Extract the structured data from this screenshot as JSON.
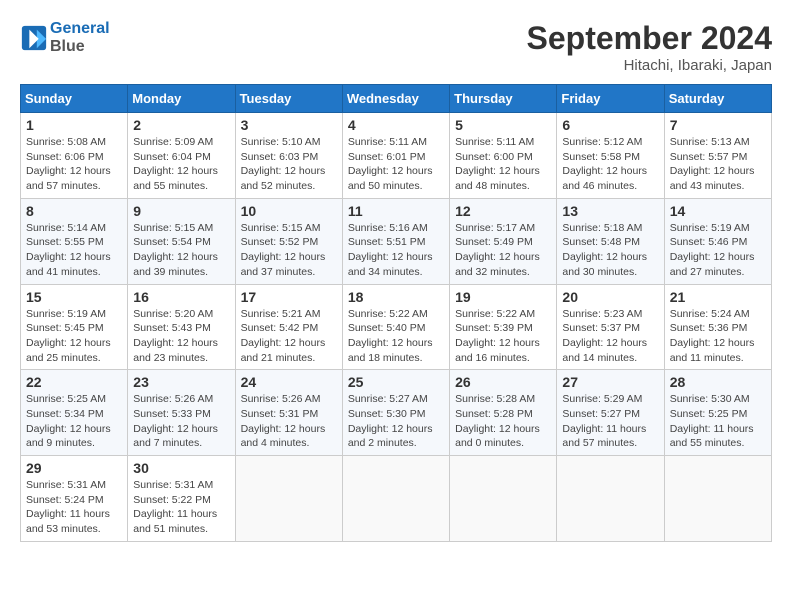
{
  "header": {
    "logo_line1": "General",
    "logo_line2": "Blue",
    "month": "September 2024",
    "location": "Hitachi, Ibaraki, Japan"
  },
  "weekdays": [
    "Sunday",
    "Monday",
    "Tuesday",
    "Wednesday",
    "Thursday",
    "Friday",
    "Saturday"
  ],
  "weeks": [
    [
      {
        "day": "1",
        "sunrise": "Sunrise: 5:08 AM",
        "sunset": "Sunset: 6:06 PM",
        "daylight": "Daylight: 12 hours and 57 minutes."
      },
      {
        "day": "2",
        "sunrise": "Sunrise: 5:09 AM",
        "sunset": "Sunset: 6:04 PM",
        "daylight": "Daylight: 12 hours and 55 minutes."
      },
      {
        "day": "3",
        "sunrise": "Sunrise: 5:10 AM",
        "sunset": "Sunset: 6:03 PM",
        "daylight": "Daylight: 12 hours and 52 minutes."
      },
      {
        "day": "4",
        "sunrise": "Sunrise: 5:11 AM",
        "sunset": "Sunset: 6:01 PM",
        "daylight": "Daylight: 12 hours and 50 minutes."
      },
      {
        "day": "5",
        "sunrise": "Sunrise: 5:11 AM",
        "sunset": "Sunset: 6:00 PM",
        "daylight": "Daylight: 12 hours and 48 minutes."
      },
      {
        "day": "6",
        "sunrise": "Sunrise: 5:12 AM",
        "sunset": "Sunset: 5:58 PM",
        "daylight": "Daylight: 12 hours and 46 minutes."
      },
      {
        "day": "7",
        "sunrise": "Sunrise: 5:13 AM",
        "sunset": "Sunset: 5:57 PM",
        "daylight": "Daylight: 12 hours and 43 minutes."
      }
    ],
    [
      {
        "day": "8",
        "sunrise": "Sunrise: 5:14 AM",
        "sunset": "Sunset: 5:55 PM",
        "daylight": "Daylight: 12 hours and 41 minutes."
      },
      {
        "day": "9",
        "sunrise": "Sunrise: 5:15 AM",
        "sunset": "Sunset: 5:54 PM",
        "daylight": "Daylight: 12 hours and 39 minutes."
      },
      {
        "day": "10",
        "sunrise": "Sunrise: 5:15 AM",
        "sunset": "Sunset: 5:52 PM",
        "daylight": "Daylight: 12 hours and 37 minutes."
      },
      {
        "day": "11",
        "sunrise": "Sunrise: 5:16 AM",
        "sunset": "Sunset: 5:51 PM",
        "daylight": "Daylight: 12 hours and 34 minutes."
      },
      {
        "day": "12",
        "sunrise": "Sunrise: 5:17 AM",
        "sunset": "Sunset: 5:49 PM",
        "daylight": "Daylight: 12 hours and 32 minutes."
      },
      {
        "day": "13",
        "sunrise": "Sunrise: 5:18 AM",
        "sunset": "Sunset: 5:48 PM",
        "daylight": "Daylight: 12 hours and 30 minutes."
      },
      {
        "day": "14",
        "sunrise": "Sunrise: 5:19 AM",
        "sunset": "Sunset: 5:46 PM",
        "daylight": "Daylight: 12 hours and 27 minutes."
      }
    ],
    [
      {
        "day": "15",
        "sunrise": "Sunrise: 5:19 AM",
        "sunset": "Sunset: 5:45 PM",
        "daylight": "Daylight: 12 hours and 25 minutes."
      },
      {
        "day": "16",
        "sunrise": "Sunrise: 5:20 AM",
        "sunset": "Sunset: 5:43 PM",
        "daylight": "Daylight: 12 hours and 23 minutes."
      },
      {
        "day": "17",
        "sunrise": "Sunrise: 5:21 AM",
        "sunset": "Sunset: 5:42 PM",
        "daylight": "Daylight: 12 hours and 21 minutes."
      },
      {
        "day": "18",
        "sunrise": "Sunrise: 5:22 AM",
        "sunset": "Sunset: 5:40 PM",
        "daylight": "Daylight: 12 hours and 18 minutes."
      },
      {
        "day": "19",
        "sunrise": "Sunrise: 5:22 AM",
        "sunset": "Sunset: 5:39 PM",
        "daylight": "Daylight: 12 hours and 16 minutes."
      },
      {
        "day": "20",
        "sunrise": "Sunrise: 5:23 AM",
        "sunset": "Sunset: 5:37 PM",
        "daylight": "Daylight: 12 hours and 14 minutes."
      },
      {
        "day": "21",
        "sunrise": "Sunrise: 5:24 AM",
        "sunset": "Sunset: 5:36 PM",
        "daylight": "Daylight: 12 hours and 11 minutes."
      }
    ],
    [
      {
        "day": "22",
        "sunrise": "Sunrise: 5:25 AM",
        "sunset": "Sunset: 5:34 PM",
        "daylight": "Daylight: 12 hours and 9 minutes."
      },
      {
        "day": "23",
        "sunrise": "Sunrise: 5:26 AM",
        "sunset": "Sunset: 5:33 PM",
        "daylight": "Daylight: 12 hours and 7 minutes."
      },
      {
        "day": "24",
        "sunrise": "Sunrise: 5:26 AM",
        "sunset": "Sunset: 5:31 PM",
        "daylight": "Daylight: 12 hours and 4 minutes."
      },
      {
        "day": "25",
        "sunrise": "Sunrise: 5:27 AM",
        "sunset": "Sunset: 5:30 PM",
        "daylight": "Daylight: 12 hours and 2 minutes."
      },
      {
        "day": "26",
        "sunrise": "Sunrise: 5:28 AM",
        "sunset": "Sunset: 5:28 PM",
        "daylight": "Daylight: 12 hours and 0 minutes."
      },
      {
        "day": "27",
        "sunrise": "Sunrise: 5:29 AM",
        "sunset": "Sunset: 5:27 PM",
        "daylight": "Daylight: 11 hours and 57 minutes."
      },
      {
        "day": "28",
        "sunrise": "Sunrise: 5:30 AM",
        "sunset": "Sunset: 5:25 PM",
        "daylight": "Daylight: 11 hours and 55 minutes."
      }
    ],
    [
      {
        "day": "29",
        "sunrise": "Sunrise: 5:31 AM",
        "sunset": "Sunset: 5:24 PM",
        "daylight": "Daylight: 11 hours and 53 minutes."
      },
      {
        "day": "30",
        "sunrise": "Sunrise: 5:31 AM",
        "sunset": "Sunset: 5:22 PM",
        "daylight": "Daylight: 11 hours and 51 minutes."
      },
      {
        "day": "",
        "sunrise": "",
        "sunset": "",
        "daylight": ""
      },
      {
        "day": "",
        "sunrise": "",
        "sunset": "",
        "daylight": ""
      },
      {
        "day": "",
        "sunrise": "",
        "sunset": "",
        "daylight": ""
      },
      {
        "day": "",
        "sunrise": "",
        "sunset": "",
        "daylight": ""
      },
      {
        "day": "",
        "sunrise": "",
        "sunset": "",
        "daylight": ""
      }
    ]
  ]
}
